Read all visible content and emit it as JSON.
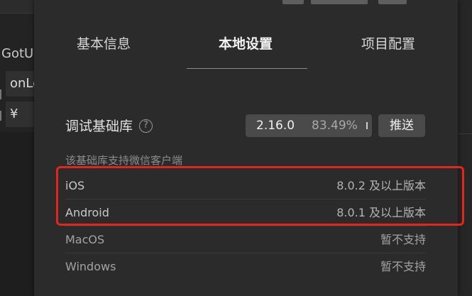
{
  "background": {
    "left_label": "GotU",
    "left_field_1": "onLo",
    "left_field_2": "¥"
  },
  "tabs": [
    {
      "label": "基本信息",
      "active": false
    },
    {
      "label": "本地设置",
      "active": true
    },
    {
      "label": "项目配置",
      "active": false
    }
  ],
  "debug": {
    "label": "调试基础库",
    "help_icon": "question-circle-icon",
    "version": "2.16.0",
    "percent": "83.49%",
    "push_label": "推送"
  },
  "support": {
    "heading": "该基础库支持微信客户端",
    "rows": [
      {
        "name": "iOS",
        "value": "8.0.2 及以上版本"
      },
      {
        "name": "Android",
        "value": "8.0.1 及以上版本"
      },
      {
        "name": "MacOS",
        "value": "暂不支持"
      },
      {
        "name": "Windows",
        "value": "暂不支持"
      }
    ]
  },
  "colors": {
    "panel_bg": "#2b2b2b",
    "highlight": "#e0261d",
    "control_bg": "#4a4a4a"
  }
}
